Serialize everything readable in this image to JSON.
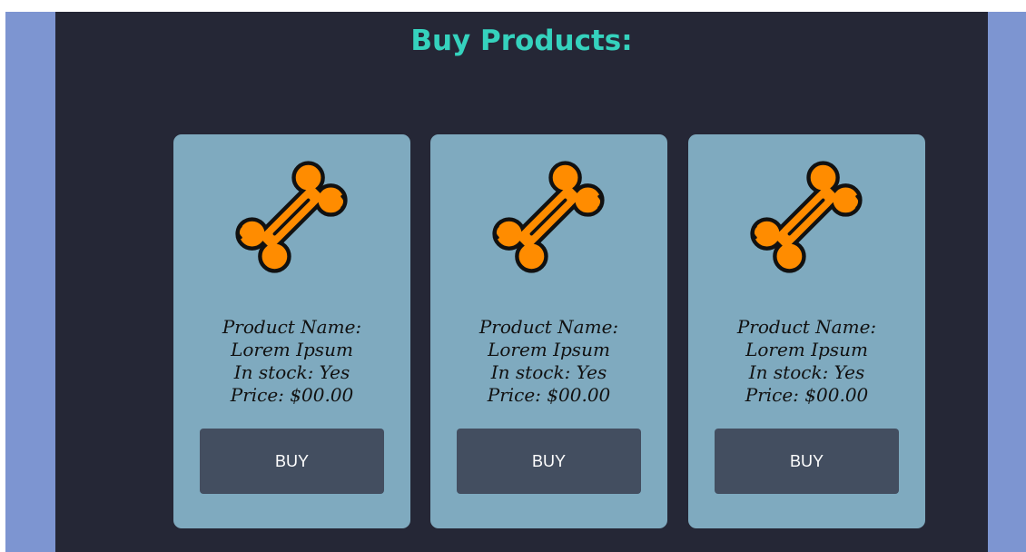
{
  "page": {
    "title": "Buy Products:"
  },
  "colors": {
    "side_panel": "#7d95d1",
    "main_bg": "#252736",
    "title": "#35d2bd",
    "card_bg": "#7faabf",
    "button_bg": "#434e60",
    "bone_fill": "#ff8c00"
  },
  "products": [
    {
      "icon": "bone-icon",
      "name_line": "Product Name:",
      "name": "Lorem Ipsum",
      "stock": "In stock: Yes",
      "price": "Price: $00.00",
      "button_label": "BUY"
    },
    {
      "icon": "bone-icon",
      "name_line": "Product Name:",
      "name": "Lorem Ipsum",
      "stock": "In stock: Yes",
      "price": "Price: $00.00",
      "button_label": "BUY"
    },
    {
      "icon": "bone-icon",
      "name_line": "Product Name:",
      "name": "Lorem Ipsum",
      "stock": "In stock: Yes",
      "price": "Price: $00.00",
      "button_label": "BUY"
    }
  ]
}
